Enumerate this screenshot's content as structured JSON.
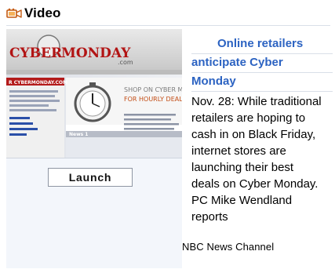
{
  "widget": {
    "title": "Video",
    "title_icon": "video-camera-icon"
  },
  "thumbnail": {
    "banner_left": "CYBER",
    "banner_right": "MONDAY",
    "banner_sub": ".com",
    "panel_title": "SHOP ON CYBER M",
    "panel_title_2": "FOR HOURLY DEAL",
    "panel_title_3": "",
    "site_label": "R CYBERMONDAY.COM",
    "news_label": "News 1",
    "watch_icon": "stopwatch-icon"
  },
  "launch_button": {
    "label": "Launch"
  },
  "story": {
    "headline_lines": [
      "Online retailers",
      "anticipate Cyber",
      "Monday"
    ],
    "summary_lines": [
      "Nov. 28: While traditional",
      "retailers are hoping to",
      "cash in on Black Friday,",
      "internet stores are",
      "launching their best",
      "deals on Cyber Monday.",
      "PC Mike Wendland",
      "reports"
    ]
  },
  "source": {
    "label": "NBC News Channel"
  },
  "colors": {
    "headline": "#2c63c2",
    "panel_background": "#f3f6fb",
    "separator": "#d9dfe8"
  }
}
